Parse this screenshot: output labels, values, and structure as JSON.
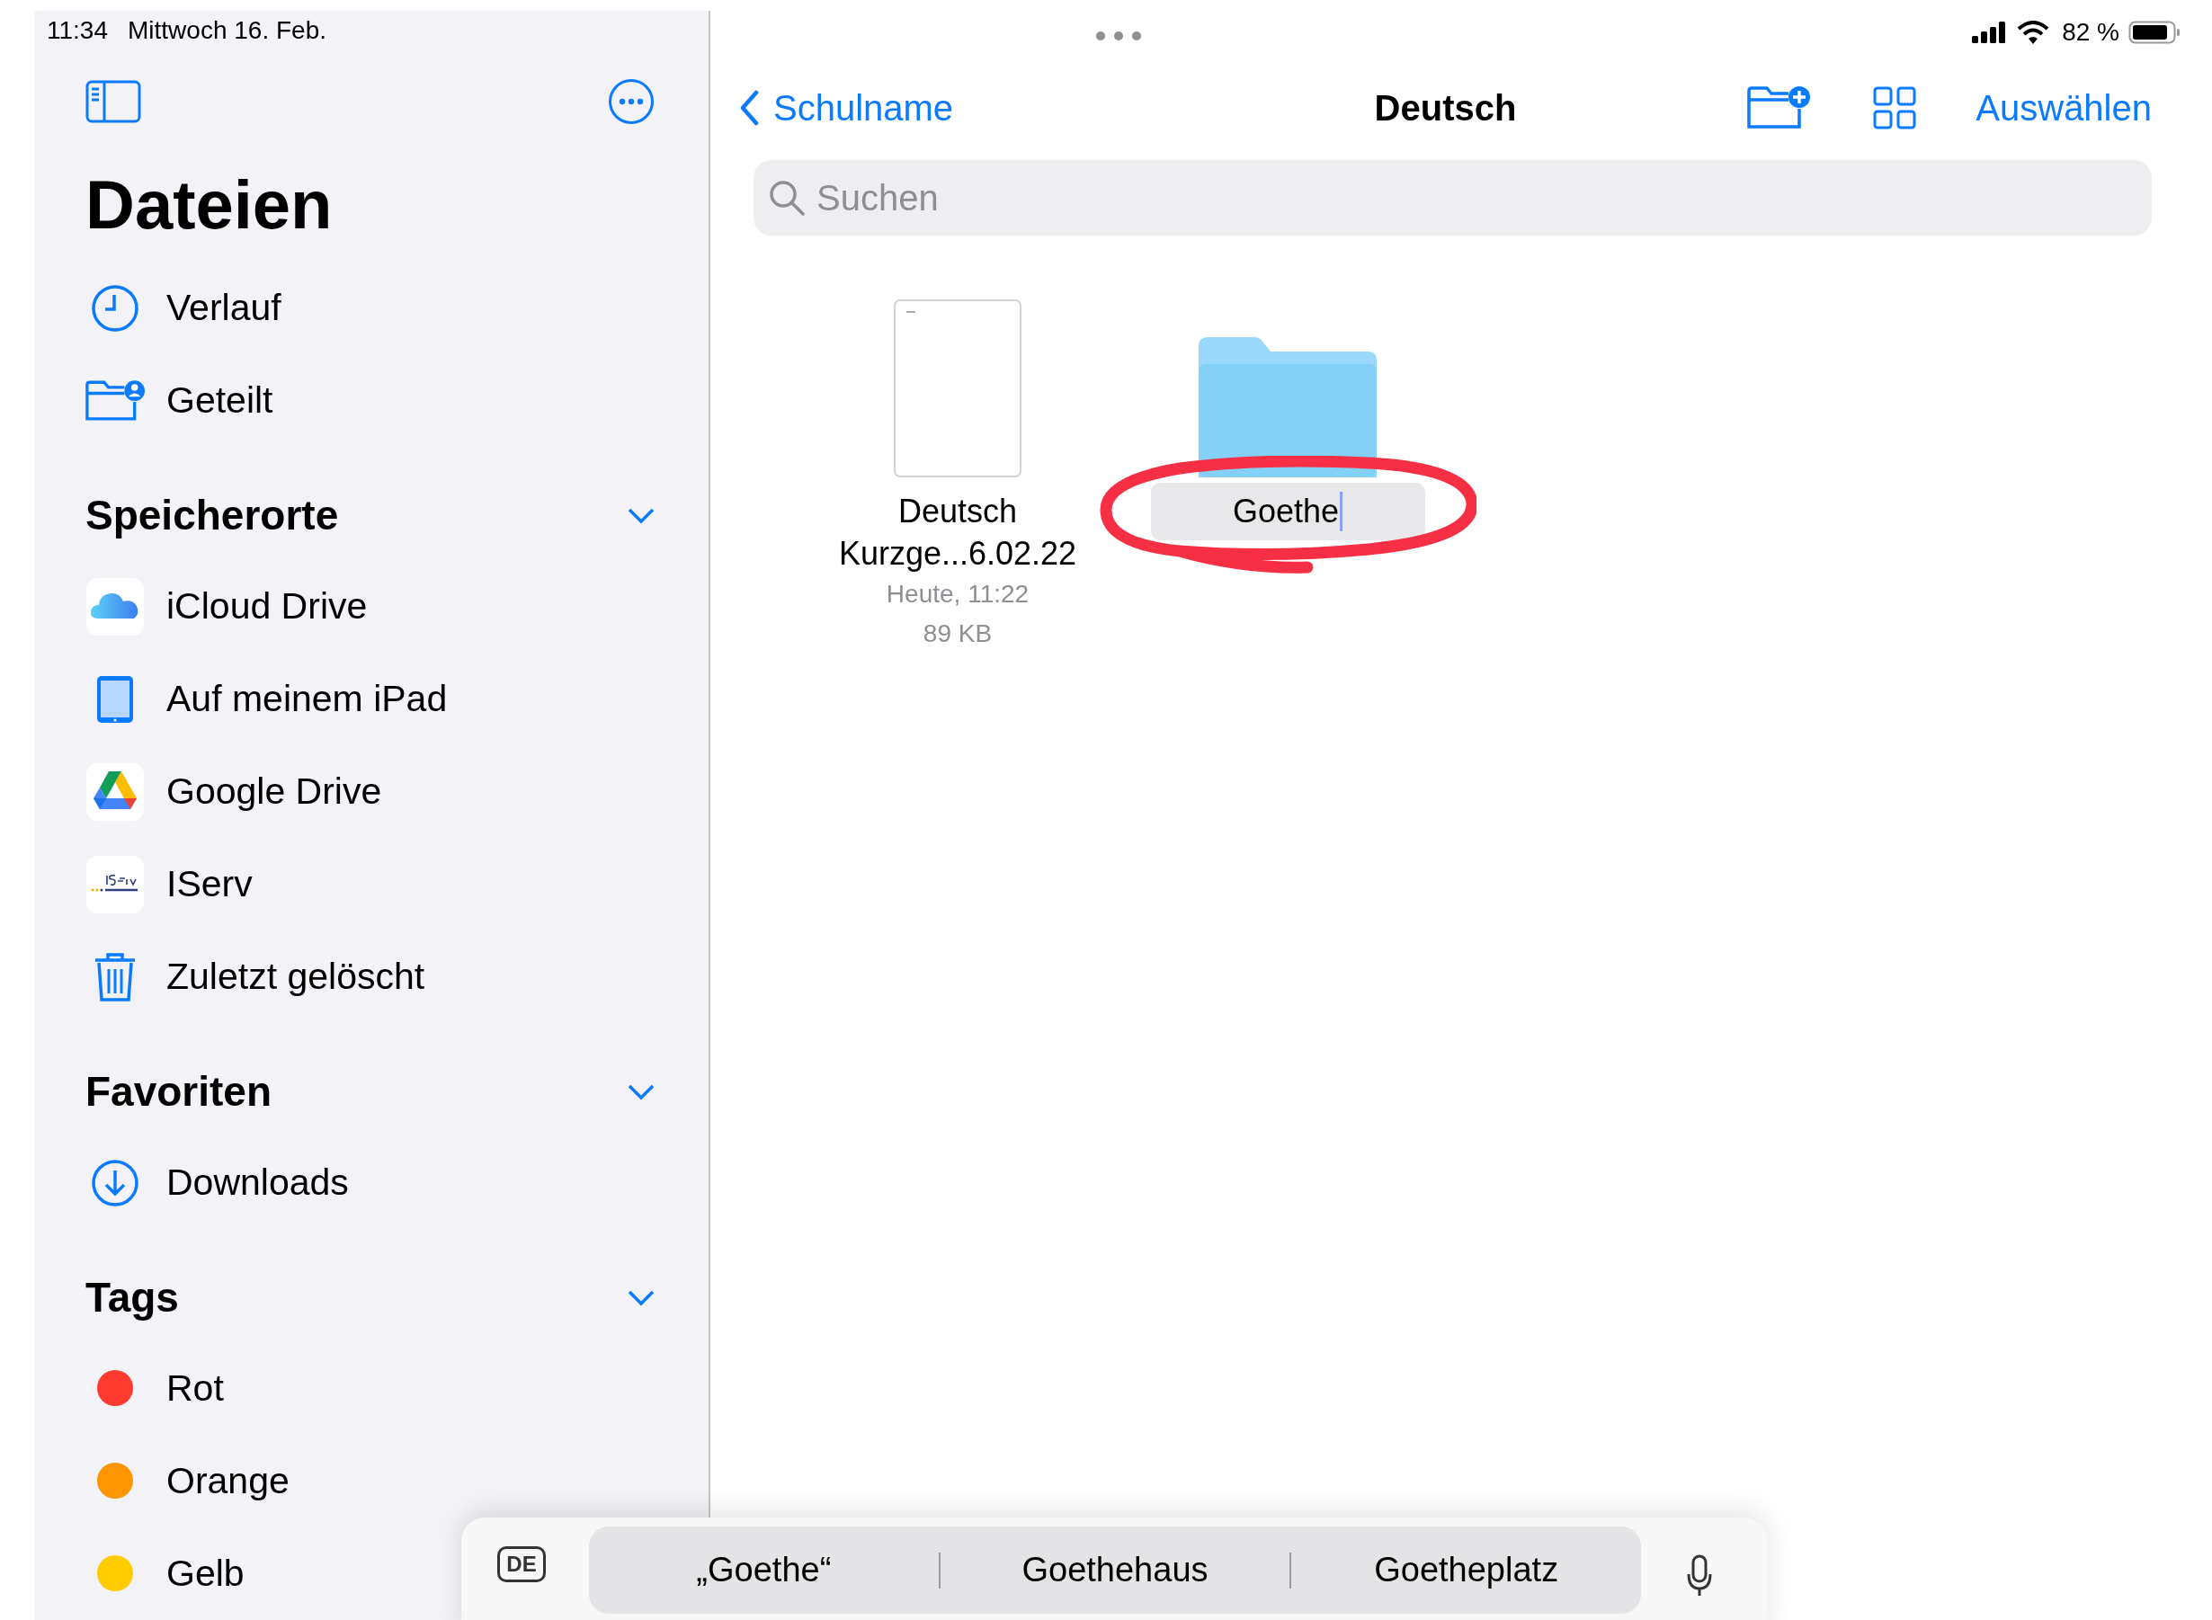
{
  "status_bar": {
    "time": "11:34",
    "date": "Mittwoch 16. Feb.",
    "battery": "82 %"
  },
  "sidebar": {
    "title": "Dateien",
    "items": [
      {
        "label": "Verlauf",
        "kind": "recents"
      },
      {
        "label": "Geteilt",
        "kind": "shared"
      }
    ],
    "sections": [
      {
        "title": "Speicherorte",
        "expanded": true,
        "items": [
          {
            "label": "iCloud Drive",
            "kind": "icloud"
          },
          {
            "label": "Auf meinem iPad",
            "kind": "ipad"
          },
          {
            "label": "Google Drive",
            "kind": "gdrive"
          },
          {
            "label": "IServ",
            "kind": "iserv"
          },
          {
            "label": "Zuletzt gelöscht",
            "kind": "trash"
          }
        ]
      },
      {
        "title": "Favoriten",
        "expanded": true,
        "items": [
          {
            "label": "Downloads",
            "kind": "downloads"
          }
        ]
      },
      {
        "title": "Tags",
        "expanded": true,
        "items": [
          {
            "label": "Rot",
            "kind": "tag",
            "color": "#ff3b30"
          },
          {
            "label": "Orange",
            "kind": "tag",
            "color": "#ff9500"
          },
          {
            "label": "Gelb",
            "kind": "tag",
            "color": "#ffcc00"
          }
        ]
      }
    ]
  },
  "toolbar": {
    "back": "Schulname",
    "title": "Deutsch",
    "select": "Auswählen"
  },
  "search": {
    "placeholder": "Suchen"
  },
  "items": [
    {
      "kind": "document",
      "name": "Deutsch Kurzge...6.02.22",
      "date": "Heute, 11:22",
      "size": "89 KB"
    },
    {
      "kind": "folder",
      "name": "Goethe",
      "editing": true,
      "circled": true
    }
  ],
  "keyboard": {
    "language": "DE",
    "suggestions": [
      "„Goethe“",
      "Goethehaus",
      "Goetheplatz"
    ]
  }
}
